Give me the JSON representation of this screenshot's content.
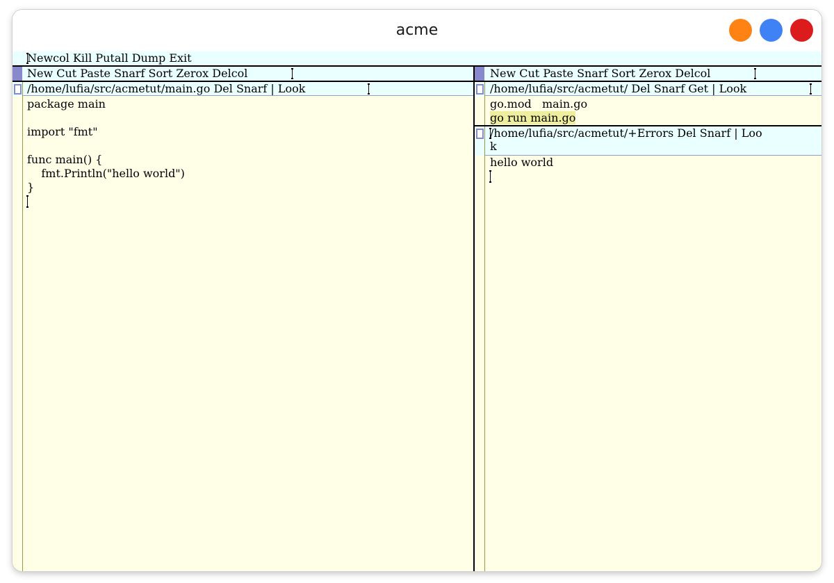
{
  "window": {
    "title": "acme",
    "button_colors": {
      "minimize": "#ff8214",
      "maximize": "#3f82f5",
      "close": "#dc1c1c"
    }
  },
  "colors": {
    "tag_background": "#eaffff",
    "body_background": "#ffffe8",
    "selection": "#eeee9e",
    "layout_box": "#8888cc"
  },
  "main_tag": "Newcol Kill Putall Dump Exit",
  "columns": [
    {
      "tag": "New Cut Paste Snarf Sort Zerox Delcol",
      "windows": [
        {
          "tag": "/home/lufia/src/acmetut/main.go Del Snarf | Look",
          "body": "package main\n\nimport \"fmt\"\n\nfunc main() {\n    fmt.Println(\"hello world\")\n}"
        }
      ]
    },
    {
      "tag": "New Cut Paste Snarf Sort Zerox Delcol",
      "windows": [
        {
          "tag": "/home/lufia/src/acmetut/ Del Snarf Get | Look",
          "body_line1": "go.mod   main.go",
          "selected_text": "go run main.go"
        },
        {
          "tag_line1": "/home/lufia/src/acmetut/+Errors Del Snarf | Loo",
          "tag_line2": "k",
          "body": "hello world"
        }
      ]
    }
  ]
}
